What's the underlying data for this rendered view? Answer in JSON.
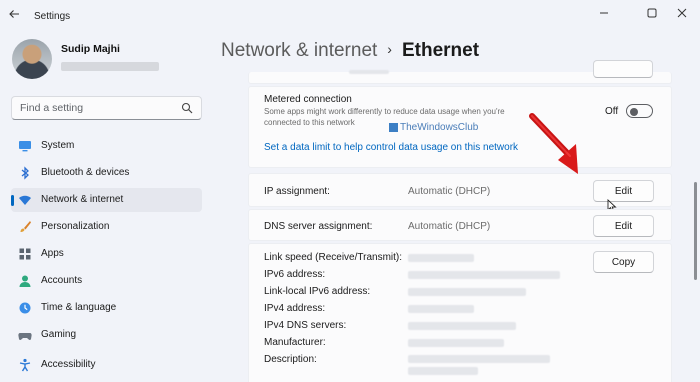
{
  "window": {
    "title": "Settings"
  },
  "profile": {
    "name": "Sudip Majhi"
  },
  "search": {
    "placeholder": "Find a setting"
  },
  "sidebar": {
    "items": [
      {
        "label": "System",
        "icon": "monitor-icon"
      },
      {
        "label": "Bluetooth & devices",
        "icon": "bluetooth-icon"
      },
      {
        "label": "Network & internet",
        "icon": "wifi-icon",
        "active": true
      },
      {
        "label": "Personalization",
        "icon": "brush-icon"
      },
      {
        "label": "Apps",
        "icon": "apps-icon"
      },
      {
        "label": "Accounts",
        "icon": "person-icon"
      },
      {
        "label": "Time & language",
        "icon": "globe-clock-icon"
      },
      {
        "label": "Gaming",
        "icon": "controller-icon"
      },
      {
        "label": "Accessibility",
        "icon": "accessibility-icon"
      }
    ]
  },
  "breadcrumb": {
    "parent": "Network & internet",
    "separator": "›",
    "current": "Ethernet"
  },
  "metered": {
    "title": "Metered connection",
    "description_line1": "Some apps might work differently to reduce data usage when you're",
    "description_line2": "connected to this network",
    "toggle_label": "Off",
    "toggle_on": false,
    "link": "Set a data limit to help control data usage on this network"
  },
  "watermark": "TheWindowsClub",
  "ip_assignment": {
    "label": "IP assignment:",
    "value": "Automatic (DHCP)",
    "button": "Edit"
  },
  "dns_assignment": {
    "label": "DNS server assignment:",
    "value": "Automatic (DHCP)",
    "button": "Edit"
  },
  "properties": {
    "copy_button": "Copy",
    "labels": [
      "Link speed (Receive/Transmit):",
      "IPv6 address:",
      "Link-local IPv6 address:",
      "IPv4 address:",
      "IPv4 DNS servers:",
      "Manufacturer:",
      "Description:"
    ]
  },
  "colors": {
    "accent": "#0067c0",
    "arrow": "#e02020",
    "link": "#0067c0"
  }
}
